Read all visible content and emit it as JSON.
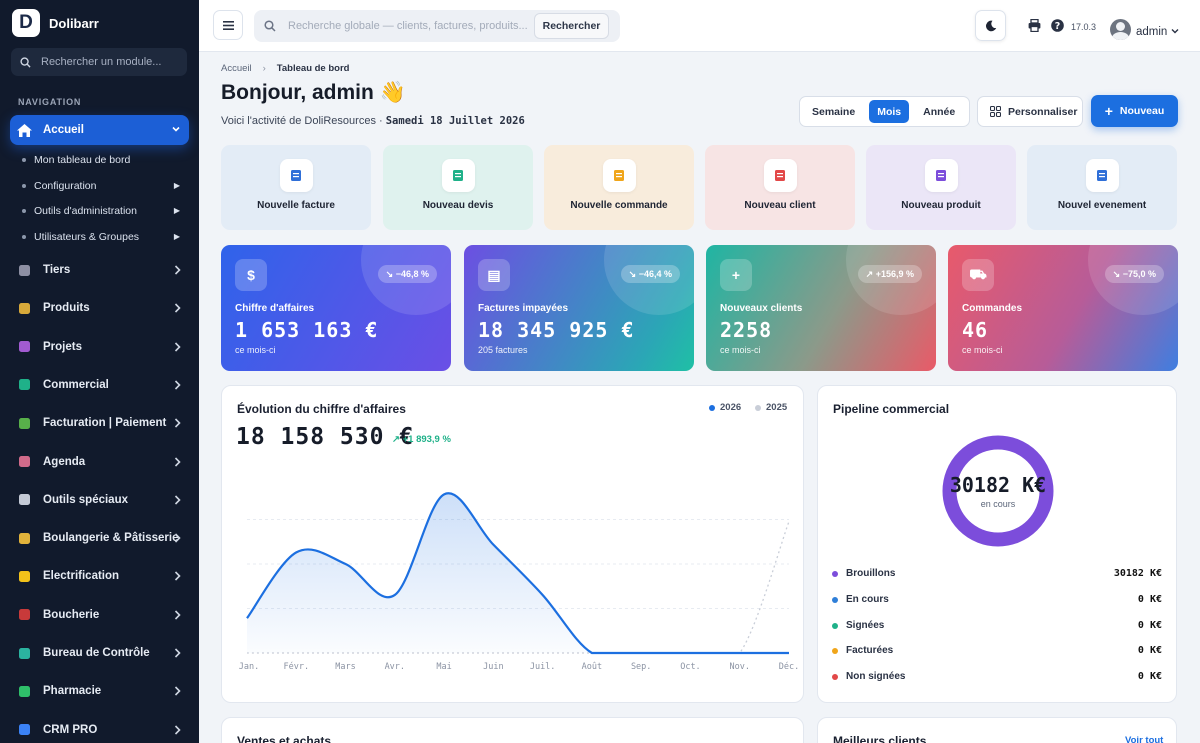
{
  "app": {
    "name": "Dolibarr",
    "logo_letter": "D"
  },
  "sidebar": {
    "search_placeholder": "Rechercher un module...",
    "section_title": "NAVIGATION",
    "active": {
      "label": "Accueil",
      "icon": "home-icon"
    },
    "subitems": [
      {
        "label": "Mon tableau de bord",
        "has_arrow": false
      },
      {
        "label": "Configuration",
        "has_arrow": true
      },
      {
        "label": "Outils d'administration",
        "has_arrow": true
      },
      {
        "label": "Utilisateurs & Groupes",
        "has_arrow": true
      }
    ],
    "items": [
      {
        "label": "Tiers",
        "icon": "building-icon",
        "color": "#8d8fa3"
      },
      {
        "label": "Produits",
        "icon": "box-icon",
        "color": "#d8a93a"
      },
      {
        "label": "Projets",
        "icon": "diagram-icon",
        "color": "#a25bd1"
      },
      {
        "label": "Commercial",
        "icon": "briefcase-icon",
        "color": "#1fb189"
      },
      {
        "label": "Facturation | Paiement",
        "icon": "invoice-icon",
        "color": "#58b04a"
      },
      {
        "label": "Agenda",
        "icon": "calendar-icon",
        "color": "#d06a8a"
      },
      {
        "label": "Outils spéciaux",
        "icon": "tools-icon",
        "color": "#c4cad6"
      },
      {
        "label": "Boulangerie & Pâtisserie",
        "icon": "bread-icon",
        "color": "#e2b33b"
      },
      {
        "label": "Electrification",
        "icon": "lightning-icon",
        "color": "#f2c21a"
      },
      {
        "label": "Boucherie",
        "icon": "meat-icon",
        "color": "#c83a3a"
      },
      {
        "label": "Bureau de Contrôle",
        "icon": "shield-icon",
        "color": "#2bb3a0"
      },
      {
        "label": "Pharmacie",
        "icon": "cross-icon",
        "color": "#2fbf6a"
      },
      {
        "label": "CRM PRO",
        "icon": "funnel-icon",
        "color": "#3b82f6"
      }
    ]
  },
  "topbar": {
    "search_placeholder": "Recherche globale — clients, factures, produits...",
    "search_button": "Rechercher",
    "version": "17.0.3",
    "user": "admin"
  },
  "header": {
    "breadcrumb_home": "Accueil",
    "breadcrumb_current": "Tableau de bord",
    "greeting": "Bonjour, admin 👋",
    "subtitle_prefix": "Voici l'activité de DoliResources · ",
    "date": "Samedi 18 Juillet 2026",
    "periods": [
      "Semaine",
      "Mois",
      "Année"
    ],
    "active_period": "Mois",
    "customize": "Personnaliser",
    "new": "Nouveau"
  },
  "quick_actions": [
    {
      "label": "Nouvelle facture",
      "icon": "invoice-icon",
      "bg": "#e3ecf6",
      "color": "#2f6fd8"
    },
    {
      "label": "Nouveau devis",
      "icon": "quote-icon",
      "bg": "#dff2ee",
      "color": "#1fb189"
    },
    {
      "label": "Nouvelle commande",
      "icon": "cart-icon",
      "bg": "#f8ecdc",
      "color": "#f0a51a"
    },
    {
      "label": "Nouveau client",
      "icon": "client-icon",
      "bg": "#f7e4e4",
      "color": "#e24848"
    },
    {
      "label": "Nouveau produit",
      "icon": "product-icon",
      "bg": "#ebe6f7",
      "color": "#7c4ddb"
    },
    {
      "label": "Nouvel evenement",
      "icon": "event-icon",
      "bg": "#e3ecf6",
      "color": "#2f6fd8"
    }
  ],
  "kpis": [
    {
      "label": "Chiffre d'affaires",
      "value": "1 653 163 €",
      "sub": "ce mois-ci",
      "badge": "↘ −46,8 %",
      "icon": "dollar-icon"
    },
    {
      "label": "Factures impayées",
      "value": "18 345 925 €",
      "sub": "205 factures",
      "badge": "↘ −46,4 %",
      "icon": "document-icon"
    },
    {
      "label": "Nouveaux clients",
      "value": "2258",
      "sub": "ce mois-ci",
      "badge": "↗ +156,9 %",
      "icon": "user-plus-icon"
    },
    {
      "label": "Commandes",
      "value": "46",
      "sub": "ce mois-ci",
      "badge": "↘ −75,0 %",
      "icon": "cart-icon"
    }
  ],
  "revenue": {
    "title": "Évolution du chiffre d'affaires",
    "total": "18 158 530 €",
    "growth": "↗ +1 893,9 %"
  },
  "chart_data": {
    "type": "area",
    "categories": [
      "Jan.",
      "Févr.",
      "Mars",
      "Avr.",
      "Mai",
      "Juin",
      "Juil.",
      "Août",
      "Sep.",
      "Oct.",
      "Nov.",
      "Déc."
    ],
    "series": [
      {
        "name": "2026",
        "values": [
          0.9,
          2.6,
          2.3,
          1.5,
          4.1,
          2.8,
          1.5,
          0.0,
          0.0,
          0.0,
          0.0,
          0.0
        ],
        "color": "#1c6fe0"
      },
      {
        "name": "2025",
        "values": [
          0.0,
          0.0,
          0.0,
          0.0,
          0.0,
          0.0,
          0.0,
          0.0,
          0.0,
          0.0,
          0.0,
          3.4
        ],
        "color": "#c9ced8"
      }
    ],
    "ylim": [
      0,
      4.6
    ],
    "grid": true
  },
  "pipeline": {
    "title": "Pipeline commercial",
    "donut_value": "30182 K€",
    "donut_label": "en cours",
    "ring_color": "#7c4ddb",
    "rows": [
      {
        "label": "Brouillons",
        "value": "30182 K€",
        "color": "#7c4ddb"
      },
      {
        "label": "En cours",
        "value": "0 K€",
        "color": "#2f7fd8"
      },
      {
        "label": "Signées",
        "value": "0 K€",
        "color": "#1fb189"
      },
      {
        "label": "Facturées",
        "value": "0 K€",
        "color": "#f0a51a"
      },
      {
        "label": "Non signées",
        "value": "0 K€",
        "color": "#e24848"
      }
    ]
  },
  "bottom": {
    "sales_title": "Ventes et achats",
    "clients_title": "Meilleurs clients",
    "view_all": "Voir tout"
  }
}
